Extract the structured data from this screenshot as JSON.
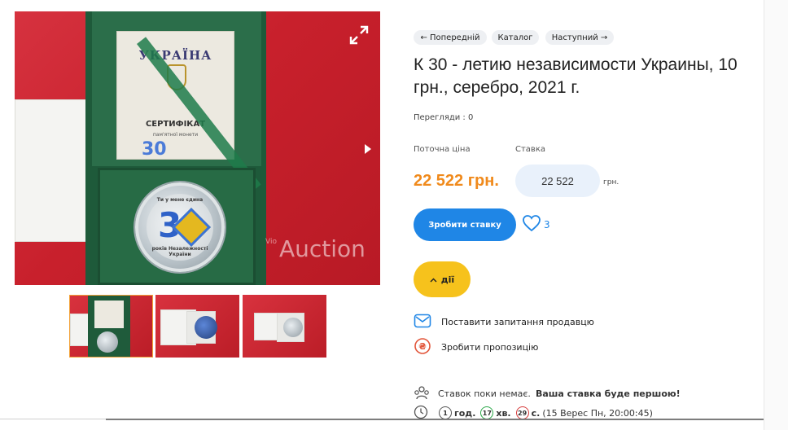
{
  "photo": {
    "certificate_title": "УКРАЇНА",
    "certificate_subtitle": "СЕРТИФІКАТ",
    "certificate_line": "пам'ятної монети",
    "certificate_number": "30",
    "coin_top_text": "Ти у мене єдина",
    "coin_number": "3",
    "coin_bottom_text": "років Незалежності України",
    "watermark": "Auction",
    "watermark_prefix": "Vio",
    "icons": {
      "expand": "expand-icon",
      "next": "arrow-right-icon"
    }
  },
  "thumbnails": [
    {
      "name": "thumb-1",
      "active": true
    },
    {
      "name": "thumb-2",
      "active": false
    },
    {
      "name": "thumb-3",
      "active": false
    }
  ],
  "nav": {
    "prev_label": "← Попередній",
    "catalog_label": "Каталог",
    "next_label": "Наступний →"
  },
  "lot": {
    "title": "К 30 - летию независимости Украины, 10 грн., серебро, 2021 г.",
    "views": "Перегляди : 0",
    "current_price_label": "Поточна ціна",
    "bid_label": "Ставка",
    "current_price": "22 522 грн.",
    "bid_value": "22 522",
    "currency": "грн.",
    "bid_button": "Зробити ставку",
    "favorites_count": "3",
    "actions_button": "дії",
    "ask_seller": "Поставити запитання продавцю",
    "make_offer": "Зробити пропозицію",
    "no_bids_text": "Ставок поки немає.",
    "first_bid_text": "Ваша ставка буде першою!",
    "timer": {
      "hours": "1",
      "hours_unit": "год.",
      "minutes": "17",
      "minutes_unit": "хв.",
      "seconds": "29",
      "seconds_unit": "с.",
      "end_time": "(15 Верес Пн, 20:00:45)"
    }
  },
  "colors": {
    "accent_blue": "#1f86e6",
    "price_orange": "#f08a1c",
    "actions_yellow": "#f6c21c",
    "pill_bg": "#eef0f3"
  }
}
